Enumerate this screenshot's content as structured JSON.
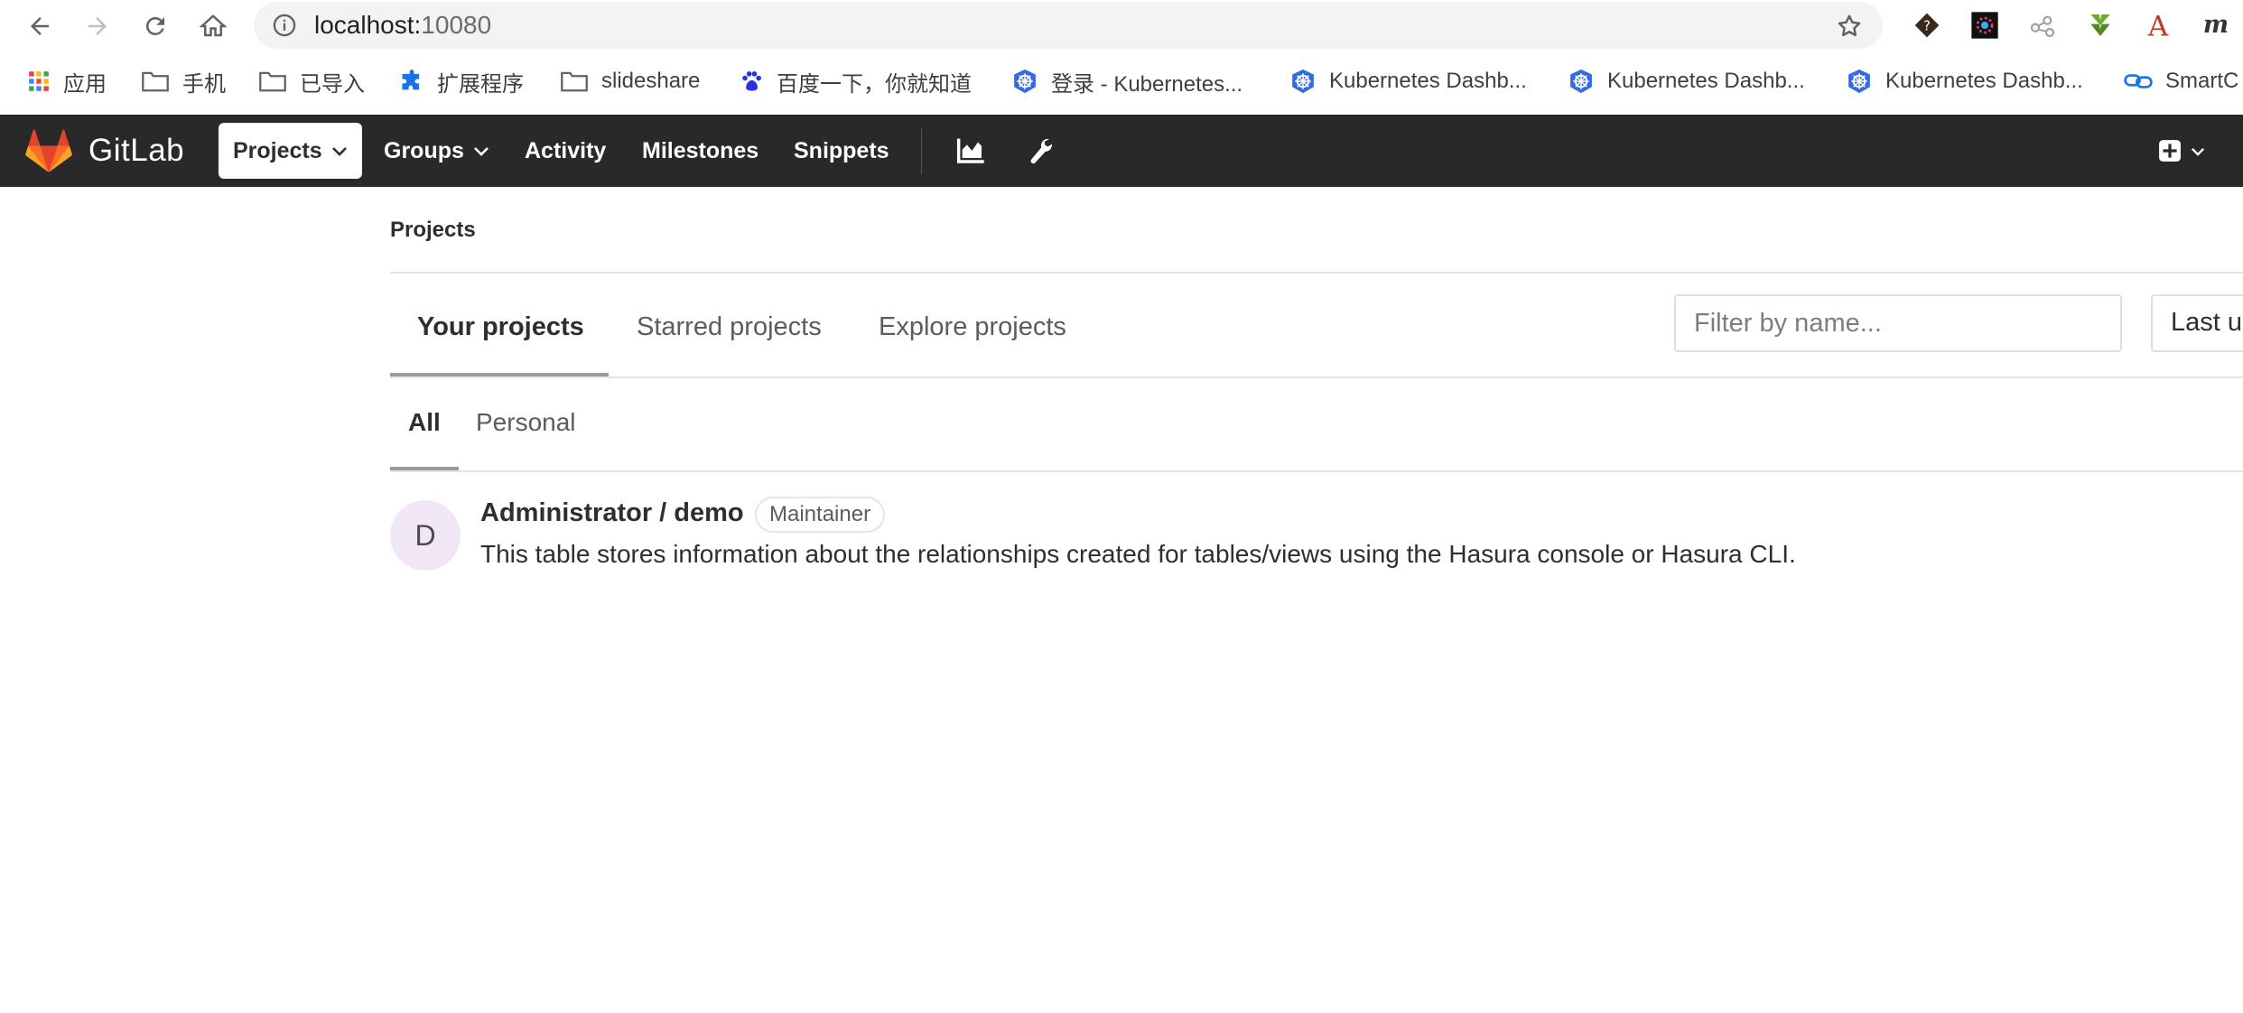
{
  "browser": {
    "url_host": "localhost:",
    "url_port": "10080",
    "bookmarks": [
      {
        "label": "应用",
        "icon": "apps-grid-icon"
      },
      {
        "label": "手机",
        "icon": "folder-icon"
      },
      {
        "label": "已导入",
        "icon": "folder-icon"
      },
      {
        "label": "扩展程序",
        "icon": "puzzle-icon"
      },
      {
        "label": "slideshare",
        "icon": "folder-icon"
      },
      {
        "label": "百度一下，你就知道",
        "icon": "baidu-paw-icon"
      },
      {
        "label": "登录 - Kubernetes...",
        "icon": "kubernetes-icon"
      },
      {
        "label": "Kubernetes Dashb...",
        "icon": "kubernetes-icon"
      },
      {
        "label": "Kubernetes Dashb...",
        "icon": "kubernetes-icon"
      },
      {
        "label": "Kubernetes Dashb...",
        "icon": "kubernetes-icon"
      },
      {
        "label": "SmartC",
        "icon": "smartc-link-icon"
      }
    ],
    "extensions": [
      "unknown-glyph-icon",
      "colorful-burst-icon",
      "nodes-icon",
      "green-arrow-icon",
      "red-a-icon",
      "m-icon"
    ]
  },
  "header": {
    "logo_text": "GitLab",
    "nav": {
      "projects": "Projects",
      "groups": "Groups",
      "activity": "Activity",
      "milestones": "Milestones",
      "snippets": "Snippets"
    },
    "icons": [
      "chart-icon",
      "wrench-icon",
      "plus-square-icon"
    ]
  },
  "page": {
    "breadcrumb": "Projects",
    "tabs": {
      "your": "Your projects",
      "starred": "Starred projects",
      "explore": "Explore projects"
    },
    "filter_placeholder": "Filter by name...",
    "sort_label": "Last u",
    "subtabs": {
      "all": "All",
      "personal": "Personal"
    },
    "projects": [
      {
        "avatar_letter": "D",
        "title": "Administrator / demo",
        "role": "Maintainer",
        "description": "This table stores information about the relationships created for tables/views using the Hasura console or Hasura CLI."
      }
    ]
  },
  "colors": {
    "header_bg": "#292929",
    "gitlab_orange": "#e24329",
    "avatar_bg": "#f1e6f5"
  }
}
